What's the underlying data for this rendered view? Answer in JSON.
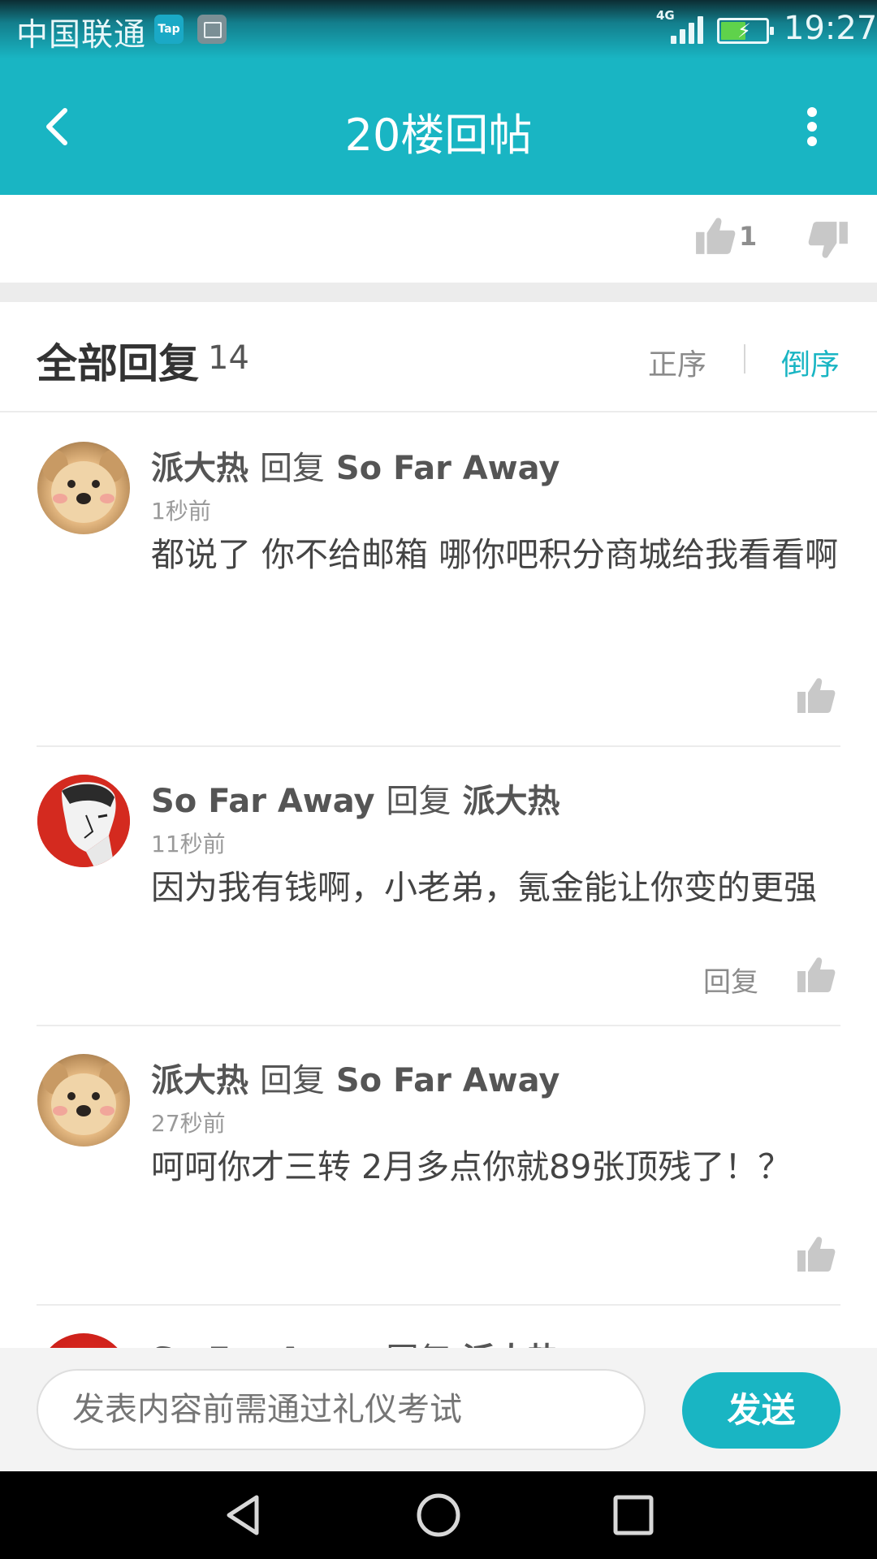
{
  "status_bar": {
    "carrier": "中国联通",
    "tap_app_label": "Tap",
    "network": "4G",
    "time": "19:27",
    "battery_level": 0.55,
    "icons": [
      "tap-app-icon",
      "gallery-icon",
      "signal-icon",
      "battery-icon"
    ]
  },
  "header": {
    "title": "20楼回帖",
    "back_icon": "chevron-left-icon",
    "menu_icon": "more-vertical-icon"
  },
  "post_votes": {
    "like_count": "1"
  },
  "replies_section": {
    "title": "全部回复",
    "count": "14",
    "sort_asc": "正序",
    "sort_desc": "倒序",
    "active_sort": "倒序"
  },
  "replies": [
    {
      "author": "派大热",
      "reply_word": "回复",
      "target": "So Far Away",
      "time": "1秒前",
      "body": "都说了 你不给邮箱 哪你吧积分商城给我看看啊",
      "reply_label": ""
    },
    {
      "author": "So Far Away",
      "reply_word": "回复",
      "target": "派大热",
      "time": "11秒前",
      "body": "因为我有钱啊，小老弟，氪金能让你变的更强",
      "reply_label": "回复"
    },
    {
      "author": "派大热",
      "reply_word": "回复",
      "target": "So Far Away",
      "time": "27秒前",
      "body": "呵呵你才三转  2月多点你就89张顶残了！？",
      "reply_label": ""
    },
    {
      "author": "So Far Away",
      "reply_word": "回复",
      "target": "派大热",
      "time": "",
      "body": "",
      "reply_label": ""
    }
  ],
  "composer": {
    "placeholder": "发表内容前需通过礼仪考试",
    "send_label": "发送"
  },
  "colors": {
    "accent": "#19b5c3",
    "background": "#ffffff",
    "separator": "#ececec"
  }
}
